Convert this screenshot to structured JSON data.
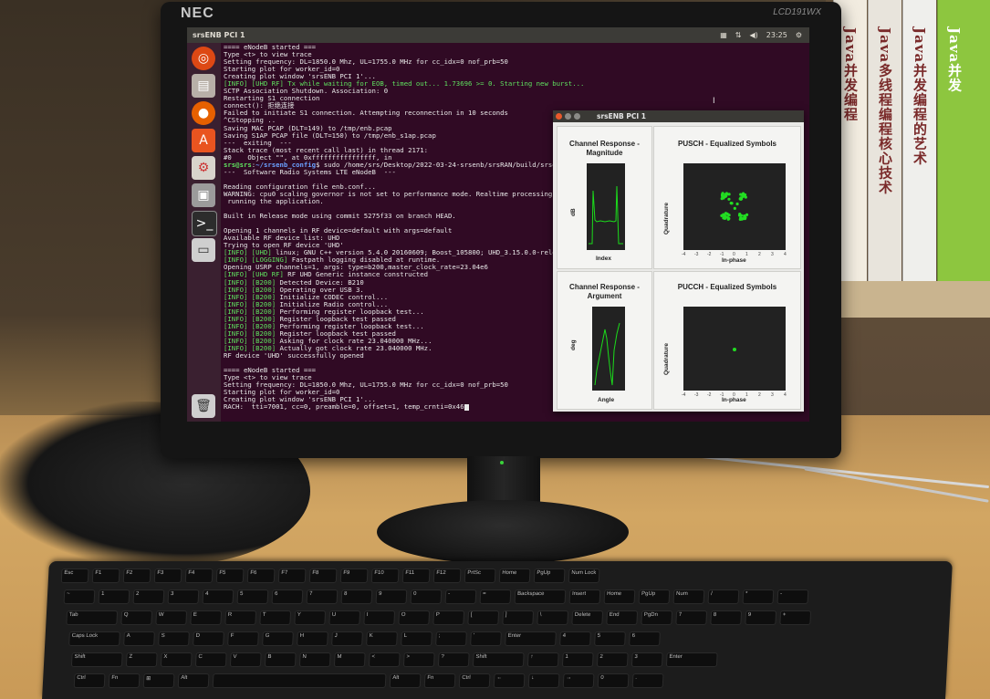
{
  "monitor": {
    "brand": "NEC",
    "model": "LCD191WX"
  },
  "topbar": {
    "window_title": "srsENB PCI 1",
    "clock": "23:25"
  },
  "books": [
    {
      "title": "Java并发编程",
      "color": "#f2ece0"
    },
    {
      "title": "Java多线程编程核心技术",
      "color": "#e8e4dc"
    },
    {
      "title": "Java并发编程的艺术",
      "color": "#efefec"
    },
    {
      "title": "Java并发",
      "color": "#8dc63f"
    }
  ],
  "terminal": {
    "lines": [
      {
        "t": "==== eNodeB started ===",
        "c": ""
      },
      {
        "t": "Type <t> to view trace",
        "c": ""
      },
      {
        "t": "Setting frequency: DL=1850.0 Mhz, UL=1755.0 MHz for cc_idx=0 nof_prb=50",
        "c": ""
      },
      {
        "t": "Starting plot for worker_id=0",
        "c": ""
      },
      {
        "t": "Creating plot window 'srsENB PCI 1'...",
        "c": ""
      },
      {
        "t": "[INFO] [UHD RF] Tx while waiting for EOB, timed out... 1.73696 >= 0. Starting new burst...",
        "c": "green"
      },
      {
        "t": "SCTP Association Shutdown. Association: 0",
        "c": ""
      },
      {
        "t": "Restarting S1 connection",
        "c": ""
      },
      {
        "t": "connect(): 拒绝连接",
        "c": ""
      },
      {
        "t": "Failed to initiate S1 connection. Attempting reconnection in 10 seconds",
        "c": ""
      },
      {
        "t": "^CStopping ..",
        "c": ""
      },
      {
        "t": "Saving MAC PCAP (DLT=149) to /tmp/enb.pcap",
        "c": ""
      },
      {
        "t": "Saving S1AP PCAP file (DLT=150) to /tmp/enb_s1ap.pcap",
        "c": ""
      },
      {
        "t": "---  exiting  ---",
        "c": ""
      },
      {
        "t": "Stack trace (most recent call last) in thread 2171:",
        "c": ""
      },
      {
        "t": "#0    Object \"\", at 0xffffffffffffffff, in",
        "c": ""
      },
      {
        "t": "srs@srs:~/srsenb_config$ sudo /home/srs/Desktop/2022-03-24-srsenb/srsRAN/build/srsenb/",
        "c": "prompt"
      },
      {
        "t": "---  Software Radio Systems LTE eNodeB  ---",
        "c": ""
      },
      {
        "t": "",
        "c": ""
      },
      {
        "t": "Reading configuration file enb.conf...",
        "c": ""
      },
      {
        "t": "WARNING: cpu0 scaling governor is not set to performance mode. Realtime processing cou",
        "c": ""
      },
      {
        "t": " running the application.",
        "c": ""
      },
      {
        "t": "",
        "c": ""
      },
      {
        "t": "Built in Release mode using commit 5275f33 on branch HEAD.",
        "c": ""
      },
      {
        "t": "",
        "c": ""
      },
      {
        "t": "Opening 1 channels in RF device=default with args=default",
        "c": ""
      },
      {
        "t": "Available RF device list: UHD",
        "c": ""
      },
      {
        "t": "Trying to open RF device 'UHD'",
        "c": ""
      },
      {
        "t": "[INFO] [UHD] linux; GNU C++ version 5.4.0 20160609; Boost_105800; UHD_3.15.0.0-release",
        "c": "tag"
      },
      {
        "t": "[INFO] [LOGGING] Fastpath logging disabled at runtime.",
        "c": "tag"
      },
      {
        "t": "Opening USRP channels=1, args: type=b200,master_clock_rate=23.04e6",
        "c": ""
      },
      {
        "t": "[INFO] [UHD RF] RF UHD Generic instance constructed",
        "c": "tag"
      },
      {
        "t": "[INFO] [B200] Detected Device: B210",
        "c": "tag"
      },
      {
        "t": "[INFO] [B200] Operating over USB 3.",
        "c": "tag"
      },
      {
        "t": "[INFO] [B200] Initialize CODEC control...",
        "c": "tag"
      },
      {
        "t": "[INFO] [B200] Initialize Radio control...",
        "c": "tag"
      },
      {
        "t": "[INFO] [B200] Performing register loopback test...",
        "c": "tag"
      },
      {
        "t": "[INFO] [B200] Register loopback test passed",
        "c": "tag"
      },
      {
        "t": "[INFO] [B200] Performing register loopback test...",
        "c": "tag"
      },
      {
        "t": "[INFO] [B200] Register loopback test passed",
        "c": "tag"
      },
      {
        "t": "[INFO] [B200] Asking for clock rate 23.040000 MHz...",
        "c": "tag"
      },
      {
        "t": "[INFO] [B200] Actually got clock rate 23.040000 MHz.",
        "c": "tag"
      },
      {
        "t": "RF device 'UHD' successfully opened",
        "c": ""
      },
      {
        "t": "",
        "c": ""
      },
      {
        "t": "==== eNodeB started ===",
        "c": ""
      },
      {
        "t": "Type <t> to view trace",
        "c": ""
      },
      {
        "t": "Setting frequency: DL=1850.0 Mhz, UL=1755.0 MHz for cc_idx=0 nof_prb=50",
        "c": ""
      },
      {
        "t": "Starting plot for worker_id=0",
        "c": ""
      },
      {
        "t": "Creating plot window 'srsENB PCI 1'...",
        "c": ""
      },
      {
        "t": "RACH:  tti=7001, cc=0, preamble=0, offset=1, temp_crnti=0x46",
        "c": ""
      }
    ]
  },
  "plot_window": {
    "title": "srsENB PCI 1",
    "panels": {
      "channel_mag": {
        "title": "Channel Response - Magnitude",
        "ylabel": "dB",
        "xlabel": "Index"
      },
      "pusch": {
        "title": "PUSCH - Equalized Symbols",
        "ylabel": "Quadrature",
        "xlabel": "In-phase"
      },
      "channel_arg": {
        "title": "Channel Response - Argument",
        "ylabel": "deg",
        "xlabel": "Angle"
      },
      "pucch": {
        "title": "PUCCH - Equalized Symbols",
        "ylabel": "Quadrature",
        "xlabel": "In-phase"
      }
    },
    "iq_ticks": [
      "-4",
      "-3",
      "-2",
      "-1",
      "0",
      "1",
      "2",
      "3",
      "4"
    ]
  },
  "keyboard": {
    "rows": [
      [
        "Esc",
        "F1",
        "F2",
        "F3",
        "F4",
        "F5",
        "F6",
        "F7",
        "F8",
        "F9",
        "F10",
        "F11",
        "F12",
        "PrtSc",
        "Home",
        "PgUp",
        "Num Lock"
      ],
      [
        "~",
        "1",
        "2",
        "3",
        "4",
        "5",
        "6",
        "7",
        "8",
        "9",
        "0",
        "-",
        "=",
        "Backspace",
        "Insert",
        "Home",
        "PgUp",
        "Num",
        "/",
        "*",
        "-"
      ],
      [
        "Tab",
        "Q",
        "W",
        "E",
        "R",
        "T",
        "Y",
        "U",
        "I",
        "O",
        "P",
        "[",
        "]",
        "\\",
        "Delete",
        "End",
        "PgDn",
        "7",
        "8",
        "9",
        "+"
      ],
      [
        "Caps Lock",
        "A",
        "S",
        "D",
        "F",
        "G",
        "H",
        "J",
        "K",
        "L",
        ";",
        "'",
        "Enter",
        "4",
        "5",
        "6"
      ],
      [
        "Shift",
        "Z",
        "X",
        "C",
        "V",
        "B",
        "N",
        "M",
        "<",
        ">",
        "?",
        "Shift",
        "↑",
        "1",
        "2",
        "3",
        "Enter"
      ],
      [
        "Ctrl",
        "Fn",
        "⊞",
        "Alt",
        "",
        "Alt",
        "Fn",
        "Ctrl",
        "←",
        "↓",
        "→",
        "0",
        "."
      ]
    ]
  },
  "colors": {
    "terminal_bg": "#300a24",
    "green": "#5fe05f",
    "plot_point": "#22dd22"
  }
}
